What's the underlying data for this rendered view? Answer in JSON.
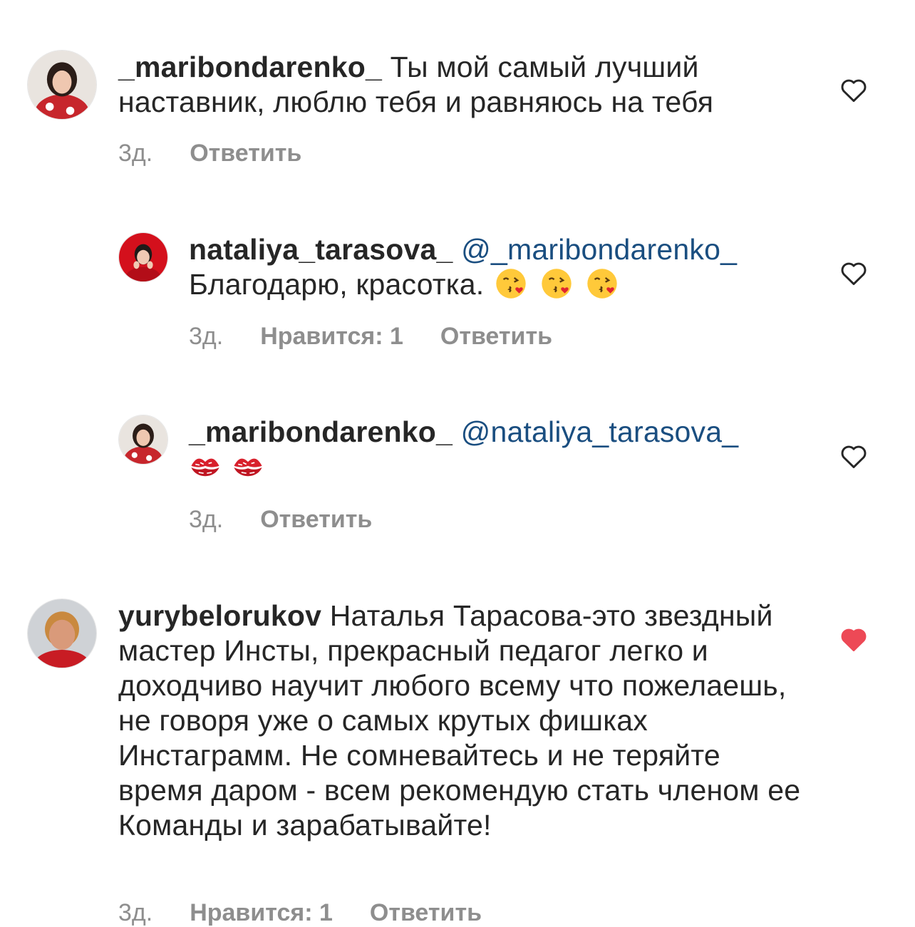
{
  "comments": [
    {
      "username": "_maribondarenko_",
      "mention": "",
      "text": "Ты мой самый лучший наставник, люблю тебя и равняюсь на тебя",
      "time": "3д.",
      "likes": "",
      "reply": "Ответить",
      "liked": false
    },
    {
      "username": "nataliya_tarasova_",
      "mention": "@_maribondarenko_",
      "text": "Благодарю, красотка.",
      "time": "3д.",
      "likes": "Нравится: 1",
      "reply": "Ответить",
      "liked": false
    },
    {
      "username": "_maribondarenko_",
      "mention": "@nataliya_tarasova_",
      "text": "",
      "time": "3д.",
      "likes": "",
      "reply": "Ответить",
      "liked": false
    },
    {
      "username": "yurybelorukov",
      "mention": "",
      "text": "Наталья Тарасова-это звездный мастер Инсты, прекрасный педагог легко и доходчиво научит любого всему что пожелаешь, не говоря уже о самых крутых фишках Инстаграмм. Не сомневайтесь и не теряйте время даром - всем рекомендую стать членом ее Команды и зарабатывайте!",
      "time": "3д.",
      "likes": "Нравится: 1",
      "reply": "Ответить",
      "liked": true
    }
  ],
  "icons": {
    "heart_outline": "heart-outline-icon",
    "heart_filled": "heart-filled-icon",
    "kiss_emoji": "face-blowing-kiss-emoji",
    "lips_emoji": "kiss-mark-emoji"
  },
  "colors": {
    "username": "#262626",
    "mention": "#1a4e80",
    "meta": "#8e8e8e",
    "liked_heart": "#ed4956"
  }
}
